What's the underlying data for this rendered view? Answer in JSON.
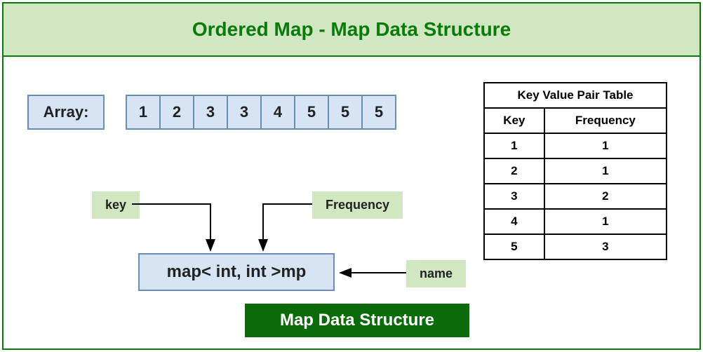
{
  "title": "Ordered Map - Map Data Structure",
  "array": {
    "label": "Array:",
    "cells": [
      "1",
      "2",
      "3",
      "3",
      "4",
      "5",
      "5",
      "5"
    ]
  },
  "annotations": {
    "key": "key",
    "frequency": "Frequency",
    "name": "name"
  },
  "map_declaration": "map< int, int >mp",
  "bottom_label": "Map Data Structure",
  "table": {
    "title": "Key Value Pair Table",
    "headers": {
      "col1": "Key",
      "col2": "Frequency"
    },
    "rows": [
      {
        "key": "1",
        "freq": "1"
      },
      {
        "key": "2",
        "freq": "1"
      },
      {
        "key": "3",
        "freq": "2"
      },
      {
        "key": "4",
        "freq": "1"
      },
      {
        "key": "5",
        "freq": "3"
      }
    ]
  }
}
